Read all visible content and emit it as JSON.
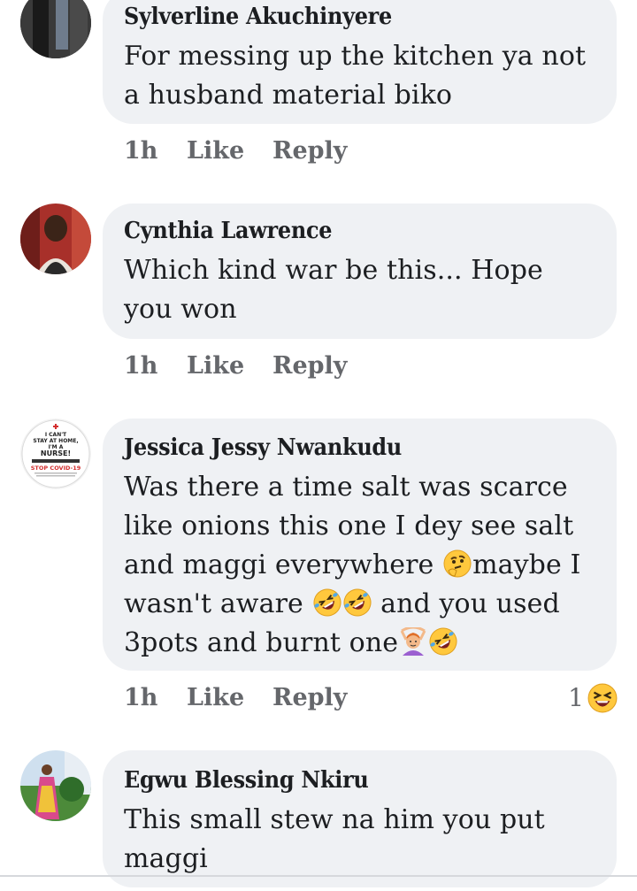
{
  "comments": [
    {
      "author": "Sylverline Akuchinyere",
      "text": "For messing up the kitchen ya not a husband material biko",
      "time": "1h",
      "like": "Like",
      "reply": "Reply"
    },
    {
      "author": "Cynthia Lawrence",
      "text": "Which kind war be this... Hope you won",
      "time": "1h",
      "like": "Like",
      "reply": "Reply"
    },
    {
      "author": "Jessica Jessy Nwankudu",
      "text_parts": [
        "Was there a time salt was scarce like onions this one I dey see salt and maggi everywhere ",
        "maybe I wasn't aware ",
        " and you used 3pots and burnt one"
      ],
      "emoji_names": [
        "thinking-emoji",
        "rolling-laughing-emoji",
        "rolling-laughing-emoji",
        "woman-gesturing-ok-emoji",
        "rolling-laughing-emoji"
      ],
      "time": "1h",
      "like": "Like",
      "reply": "Reply",
      "reaction_count": "1",
      "reaction_icon": "laughing-emoji",
      "avatar_text": {
        "line1": "I CAN'T",
        "line2": "STAY AT HOME,",
        "line3": "I'M A",
        "line4": "NURSE!",
        "line5": "STOP COVID-19"
      }
    },
    {
      "author": "Egwu Blessing Nkiru",
      "text": "This small stew na him you put maggi",
      "time": "",
      "like": "",
      "reply": ""
    }
  ],
  "colors": {
    "bubble": "#eff1f4",
    "author": "#1c1e21",
    "meta": "#65676b",
    "emoji_face": "#ffc83d"
  }
}
